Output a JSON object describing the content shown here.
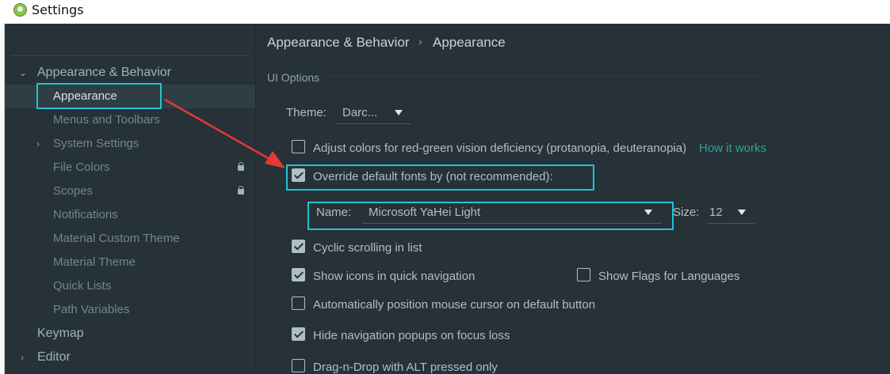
{
  "window": {
    "title": "Settings"
  },
  "sidebar": {
    "items": [
      {
        "label": "Appearance & Behavior"
      },
      {
        "label": "Appearance"
      },
      {
        "label": "Menus and Toolbars"
      },
      {
        "label": "System Settings"
      },
      {
        "label": "File Colors"
      },
      {
        "label": "Scopes"
      },
      {
        "label": "Notifications"
      },
      {
        "label": "Material Custom Theme"
      },
      {
        "label": "Material Theme"
      },
      {
        "label": "Quick Lists"
      },
      {
        "label": "Path Variables"
      },
      {
        "label": "Keymap"
      },
      {
        "label": "Editor"
      }
    ]
  },
  "breadcrumb": {
    "parent": "Appearance & Behavior",
    "current": "Appearance"
  },
  "ui_options": {
    "section_title": "UI Options",
    "theme_label": "Theme:",
    "theme_value": "Darc...",
    "adjust_colors": {
      "label": "Adjust colors for red-green vision deficiency (protanopia, deuteranopia)",
      "checked": false
    },
    "how_it_works": "How it works",
    "override_fonts": {
      "label": "Override default fonts by (not recommended):",
      "checked": true
    },
    "font_name_label": "Name:",
    "font_name_value": "Microsoft YaHei Light",
    "size_label": "Size:",
    "size_value": "12",
    "cyclic_scrolling": {
      "label": "Cyclic scrolling in list",
      "checked": true
    },
    "show_icons": {
      "label": "Show icons in quick navigation",
      "checked": true
    },
    "show_flags": {
      "label": "Show Flags for Languages",
      "checked": false
    },
    "auto_cursor": {
      "label": "Automatically position mouse cursor on default button",
      "checked": false
    },
    "hide_popups": {
      "label": "Hide navigation popups on focus loss",
      "checked": true
    },
    "drag_drop": {
      "label": "Drag-n-Drop with ALT pressed only",
      "checked": false
    }
  },
  "colors": {
    "background": "#263238",
    "highlight": "#1fc5d3",
    "annotation_arrow": "#e53935",
    "link": "#26a69a"
  }
}
